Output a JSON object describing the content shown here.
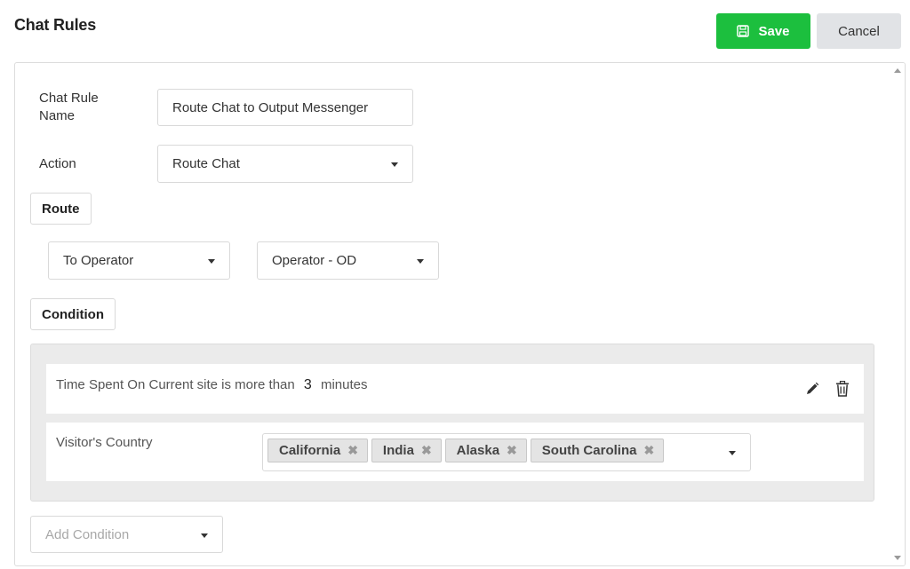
{
  "header": {
    "title": "Chat Rules",
    "save_label": "Save",
    "cancel_label": "Cancel"
  },
  "colors": {
    "save_button": "#1cbf3e",
    "cancel_button": "#e1e3e6",
    "condition_box": "#ebebeb"
  },
  "form": {
    "rule_name_label": "Chat Rule Name",
    "rule_name_value": "Route Chat to Output Messenger",
    "action_label": "Action",
    "action_value": "Route Chat",
    "route_section_label": "Route",
    "route_target_value": "To Operator",
    "route_operator_value": "Operator - OD",
    "condition_section_label": "Condition"
  },
  "conditions": {
    "time_condition": {
      "prefix": "Time Spent On Current site is more than",
      "value": "3",
      "suffix": "minutes"
    },
    "country_condition": {
      "label": "Visitor's Country",
      "tags": [
        "California",
        "India",
        "Alaska",
        "South Carolina"
      ]
    }
  },
  "add_condition": {
    "placeholder": "Add Condition"
  },
  "icons": {
    "save": "floppy-disk-icon",
    "edit": "pencil-icon",
    "delete": "trash-icon",
    "remove_tag": "✖"
  }
}
